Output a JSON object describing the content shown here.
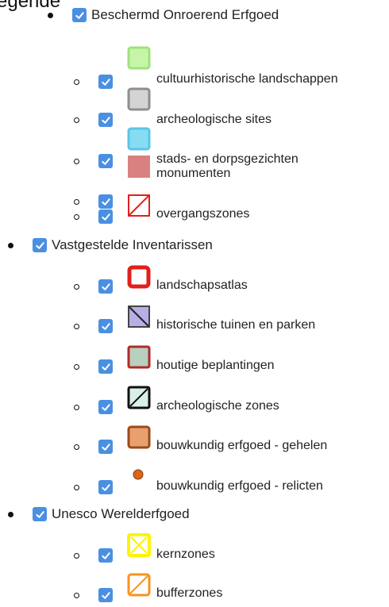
{
  "legend_title": "egende",
  "groups": [
    {
      "label": "Beschermd Onroerend Erfgoed",
      "checked": true,
      "items": [
        {
          "label": "cultuurhistorische landschappen",
          "checked": true,
          "symbol": "square-light-green"
        },
        {
          "label": "archeologische sites",
          "checked": true,
          "symbol": "square-gray"
        },
        {
          "label": "stads- en dorpsgezichten",
          "checked": true,
          "symbol": "square-light-blue"
        },
        {
          "label": "monumenten",
          "checked": true,
          "symbol": "square-rose"
        },
        {
          "label": "overgangszones",
          "checked": true,
          "symbol": "square-red-diagonal"
        }
      ]
    },
    {
      "label": "Vastgestelde Inventarissen",
      "checked": true,
      "items": [
        {
          "label": "landschapsatlas",
          "checked": true,
          "symbol": "square-red-outline"
        },
        {
          "label": "historische tuinen en parken",
          "checked": true,
          "symbol": "square-purple-diagonal"
        },
        {
          "label": "houtige beplantingen",
          "checked": true,
          "symbol": "square-sage-red-border"
        },
        {
          "label": "archeologische zones",
          "checked": true,
          "symbol": "square-black-diagonal"
        },
        {
          "label": "bouwkundig erfgoed - gehelen",
          "checked": true,
          "symbol": "square-orange-brown"
        },
        {
          "label": "bouwkundig erfgoed - relicten",
          "checked": true,
          "symbol": "dot-orange"
        }
      ]
    },
    {
      "label": "Unesco Werelderfgoed",
      "checked": true,
      "items": [
        {
          "label": "kernzones",
          "checked": true,
          "symbol": "square-yellow-cross"
        },
        {
          "label": "bufferzones",
          "checked": true,
          "symbol": "square-orange-diagonal"
        }
      ]
    }
  ],
  "colors": {
    "checkbox": "#4a90e2",
    "light_green": "#c6f5a8",
    "gray": "#d4d4d4",
    "light_blue": "#86dcf3",
    "rose": "#d98080",
    "red": "#e0201a",
    "purple": "#b9aee6",
    "sage": "#b7d0bf",
    "orange_brown": "#e9a06f",
    "orange_dot": "#d8651b",
    "yellow": "#fff400",
    "orange": "#f7941d"
  }
}
